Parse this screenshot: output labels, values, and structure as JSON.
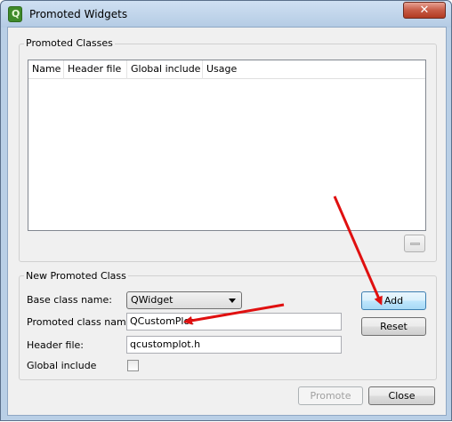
{
  "window": {
    "title": "Promoted Widgets",
    "close_glyph": "✕"
  },
  "promoted_classes": {
    "group_title": "Promoted Classes",
    "columns": [
      "Name",
      "Header file",
      "Global include",
      "Usage"
    ],
    "rows": [],
    "remove_icon": "minus-icon"
  },
  "new_class": {
    "group_title": "New Promoted Class",
    "base_class_label": "Base class name:",
    "base_class_value": "QWidget",
    "promoted_label": "Promoted class name:",
    "promoted_value": "QCustomPlot",
    "header_label": "Header file:",
    "header_value": "qcustomplot.h",
    "global_label": "Global include",
    "global_checked": false,
    "add_label": "Add",
    "reset_label": "Reset"
  },
  "footer": {
    "promote_label": "Promote",
    "close_label": "Close"
  },
  "annotations": {
    "arrow_color": "#e01010"
  }
}
